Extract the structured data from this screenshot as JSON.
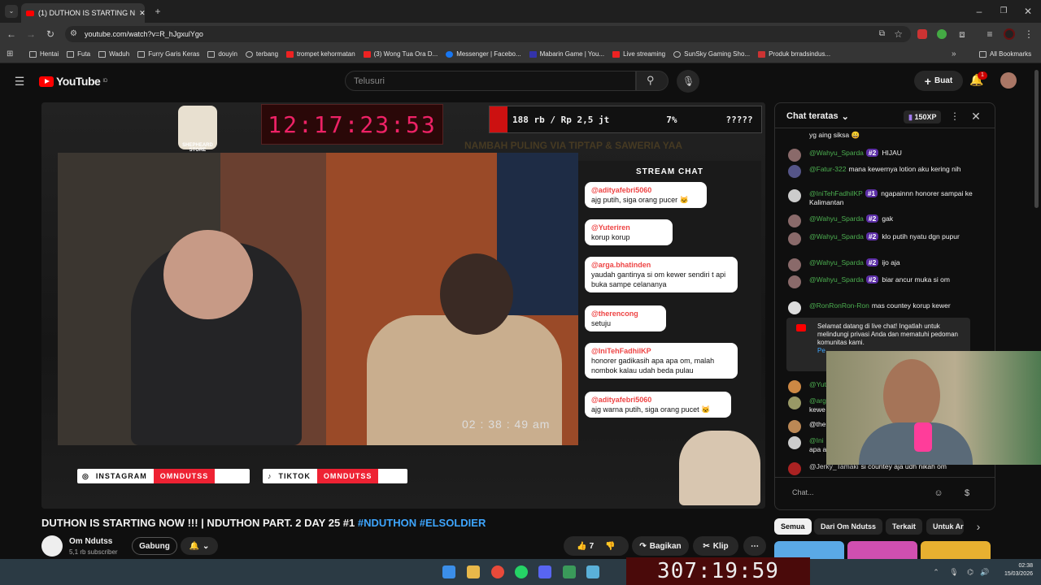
{
  "browser": {
    "tab_title": "(1) DUTHON IS STARTING N",
    "url": "youtube.com/watch?v=R_hJgxulYgo",
    "bookmarks": [
      "Hentai",
      "Futa",
      "Waduh",
      "Furry Garis Keras",
      "douyin",
      "terbang",
      "trompet kehormatan",
      "(3) Wong Tua Ora D...",
      "Messenger | Facebo...",
      "Mabarin Game | You...",
      "Live streaming",
      "SunSky Gaming Sho...",
      "Produk brradsindus..."
    ],
    "all_bookmarks": "All Bookmarks"
  },
  "youtube": {
    "logo": "YouTube",
    "logo_region": "ID",
    "search_placeholder": "Telusuri",
    "create_label": "Buat",
    "notif_count": "1"
  },
  "stream": {
    "clock": "12:17:23:53",
    "goal_text": "188 rb / Rp 2,5 jt",
    "goal_percent": "7%",
    "goal_mystery": "?????",
    "ticker": "NAMBAH PULING VIA TIPTAP & SAWERIA YAA",
    "logo_text": "SHEPHEARD STORE",
    "stream_chat_header": "STREAM CHAT",
    "stream_chat": [
      {
        "user": "@adityafebri5060",
        "text": "ajg putih, siga orang pucer 🐱"
      },
      {
        "user": "@Yuteriren",
        "text": "korup korup"
      },
      {
        "user": "@arga.bhatinden",
        "text": "yaudah gantinya si om kewer sendiri t api buka sampe celananya"
      },
      {
        "user": "@therencong",
        "text": "setuju"
      },
      {
        "user": "@IniTehFadhilKP",
        "text": "honorer gadikasih apa apa om, malah nombok kalau udah beda pulau"
      },
      {
        "user": "@adityafebri5060",
        "text": "ajg warna putih, siga orang pucet 🐱"
      }
    ],
    "video_time": "02 : 38 : 49 am",
    "instagram_label": "INSTAGRAM",
    "instagram_handle": "OMNDUTSS",
    "tiktok_label": "TIKTOK",
    "tiktok_handle": "OMNDUTSS"
  },
  "video": {
    "title": "DUTHON IS STARTING NOW !!! | NDUTHON PART. 2 DAY 25 #1",
    "hashtags": "#NDUTHON #ELSOLDIER",
    "channel": "Om Ndutss",
    "subscribers": "5,1 rb subscriber",
    "join_label": "Gabung",
    "likes": "7",
    "share_label": "Bagikan",
    "clip_label": "Klip"
  },
  "chat": {
    "header": "Chat teratas",
    "xp": "150XP",
    "top_fragment": "yg aing siksa 😀",
    "messages": [
      {
        "name": "@Wahyu_Sparda",
        "badge": "#2",
        "text": "HIJAU"
      },
      {
        "name": "@Fatur-322",
        "badge": "",
        "text": "mana kewernya lotion aku kering nih"
      },
      {
        "name": "@IniTehFadhilKP",
        "badge": "#1",
        "text": "ngapainnn honorer sampai ke Kalimantan"
      },
      {
        "name": "@Wahyu_Sparda",
        "badge": "#2",
        "text": "gak"
      },
      {
        "name": "@Wahyu_Sparda",
        "badge": "#2",
        "text": "klo putih nyatu dgn pupur"
      },
      {
        "name": "@Wahyu_Sparda",
        "badge": "#2",
        "text": "ijo aja"
      },
      {
        "name": "@Wahyu_Sparda",
        "badge": "#2",
        "text": "biar ancur muka si om"
      },
      {
        "name": "@RonRonRon-Ron",
        "badge": "",
        "text": "mas countey korup kewer"
      }
    ],
    "welcome": "Selamat datang di live chat! Ingatlah untuk melindungi privasi Anda dan mematuhi pedoman komunitas kami.",
    "welcome_link": "Pe",
    "partial_names": [
      "@Yut",
      "@arg",
      "kewe",
      "@the",
      "@Ini",
      "apa a"
    ],
    "last_message": {
      "name": "@Jerky_Tamaki",
      "text": "si countey aja udh nikah om"
    },
    "input_placeholder": "Chat..."
  },
  "chips": [
    "Semua",
    "Dari Om Ndutss",
    "Terkait",
    "Untuk Ar"
  ],
  "taskbar": {
    "big_timer": "307:19:59",
    "time": "02:38",
    "date": "15/03/2026"
  }
}
